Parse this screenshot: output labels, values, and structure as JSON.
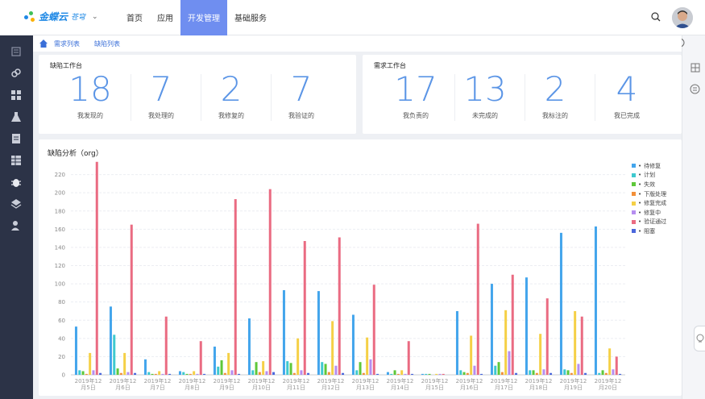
{
  "app": {
    "name": "金蝶云",
    "product": "苍穹"
  },
  "nav": {
    "items": [
      "首页",
      "应用",
      "开发管理",
      "基础服务"
    ],
    "active": 2
  },
  "breadcrumb": [
    "需求列表",
    "缺陷列表"
  ],
  "defect_workbench": {
    "title": "缺陷工作台",
    "stats": [
      {
        "value": "18",
        "label": "我发现的"
      },
      {
        "value": "7",
        "label": "我处理的"
      },
      {
        "value": "2",
        "label": "我修复的"
      },
      {
        "value": "7",
        "label": "我验证的"
      }
    ]
  },
  "req_workbench": {
    "title": "需求工作台",
    "stats": [
      {
        "value": "17",
        "label": "我负责的"
      },
      {
        "value": "13",
        "label": "未完成的"
      },
      {
        "value": "2",
        "label": "我标注的"
      },
      {
        "value": "4",
        "label": "我已完成"
      }
    ]
  },
  "colors": {
    "nav_active": "#6f8ef0",
    "stat_number": "#5b95e6",
    "sidebar": "#2c3347"
  },
  "chart_data": {
    "type": "bar",
    "title": "缺陷分析（org）",
    "ylim": [
      0,
      240
    ],
    "yticks": [
      0,
      20,
      40,
      60,
      80,
      100,
      120,
      140,
      160,
      180,
      200,
      220
    ],
    "grid": true,
    "legend_position": "top-right",
    "categories": [
      [
        "2019年12",
        "月5日"
      ],
      [
        "2019年12",
        "月6日"
      ],
      [
        "2019年12",
        "月7日"
      ],
      [
        "2019年12",
        "月8日"
      ],
      [
        "2019年12",
        "月9日"
      ],
      [
        "2019年12",
        "月10日"
      ],
      [
        "2019年12",
        "月11日"
      ],
      [
        "2019年12",
        "月12日"
      ],
      [
        "2019年12",
        "月13日"
      ],
      [
        "2019年12",
        "月14日"
      ],
      [
        "2019年12",
        "月15日"
      ],
      [
        "2019年12",
        "月16日"
      ],
      [
        "2019年12",
        "月17日"
      ],
      [
        "2019年12",
        "月18日"
      ],
      [
        "2019年12",
        "月19日"
      ],
      [
        "2019年12",
        "月20日"
      ]
    ],
    "series": [
      {
        "name": "待修复",
        "color": "#43a5ec",
        "values": [
          53,
          75,
          17,
          4,
          31,
          62,
          93,
          92,
          66,
          3,
          1,
          70,
          100,
          107,
          156,
          163
        ]
      },
      {
        "name": "计划",
        "color": "#3fc9cf",
        "values": [
          5,
          44,
          3,
          3,
          9,
          5,
          15,
          14,
          5,
          1,
          1,
          5,
          10,
          5,
          6,
          2
        ]
      },
      {
        "name": "失效",
        "color": "#5ec83a",
        "values": [
          4,
          7,
          1,
          1,
          16,
          14,
          13,
          12,
          14,
          5,
          1,
          3,
          14,
          5,
          5,
          5
        ]
      },
      {
        "name": "下版处理",
        "color": "#f28f38",
        "values": [
          1,
          2,
          1,
          1,
          2,
          3,
          2,
          3,
          2,
          1,
          0,
          2,
          3,
          2,
          2,
          2
        ]
      },
      {
        "name": "修复完成",
        "color": "#f5d046",
        "values": [
          24,
          24,
          4,
          4,
          24,
          15,
          40,
          59,
          41,
          5,
          1,
          43,
          71,
          45,
          70,
          29
        ]
      },
      {
        "name": "修复中",
        "color": "#b68ef0",
        "values": [
          5,
          3,
          1,
          1,
          5,
          4,
          5,
          10,
          17,
          1,
          1,
          10,
          26,
          6,
          12,
          6
        ]
      },
      {
        "name": "验证通过",
        "color": "#ea6b82",
        "values": [
          234,
          165,
          64,
          37,
          193,
          204,
          147,
          151,
          99,
          37,
          1,
          166,
          110,
          84,
          64,
          20
        ]
      },
      {
        "name": "阻塞",
        "color": "#4b67dc",
        "values": [
          2,
          2,
          1,
          1,
          1,
          3,
          2,
          2,
          1,
          1,
          0,
          1,
          2,
          2,
          2,
          1
        ]
      }
    ]
  }
}
